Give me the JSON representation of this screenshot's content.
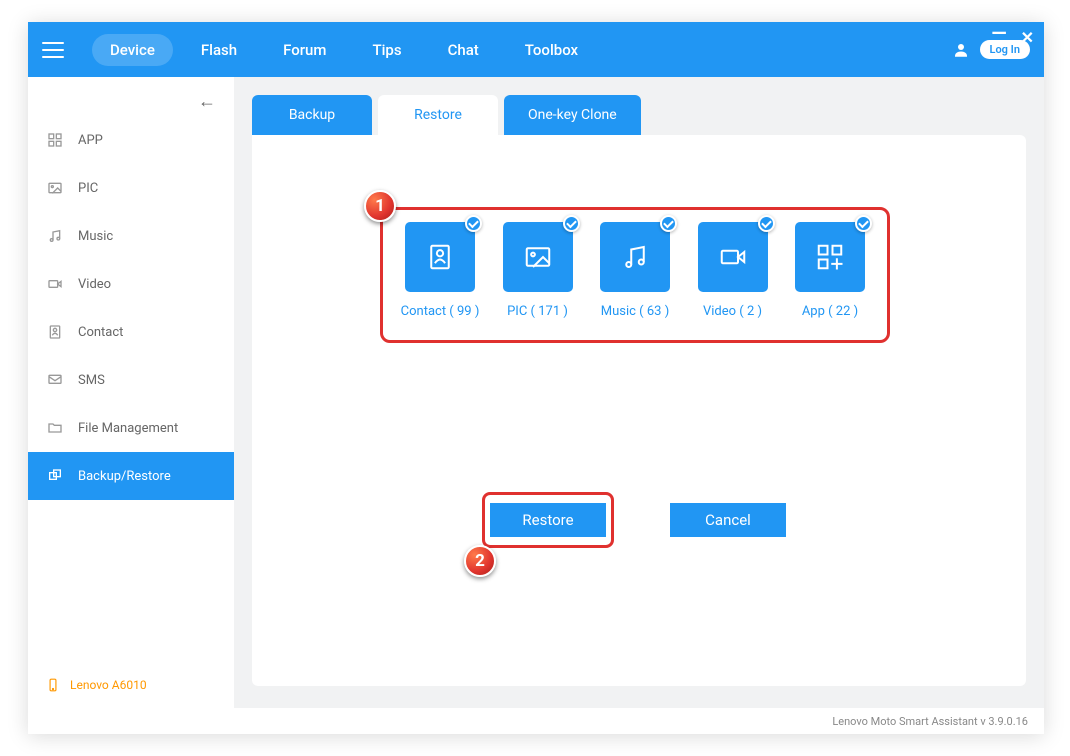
{
  "nav": {
    "items": [
      "Device",
      "Flash",
      "Forum",
      "Tips",
      "Chat",
      "Toolbox"
    ],
    "login": "Log In"
  },
  "sidebar": {
    "items": [
      {
        "label": "APP"
      },
      {
        "label": "PIC"
      },
      {
        "label": "Music"
      },
      {
        "label": "Video"
      },
      {
        "label": "Contact"
      },
      {
        "label": "SMS"
      },
      {
        "label": "File Management"
      },
      {
        "label": "Backup/Restore"
      }
    ],
    "device": "Lenovo A6010"
  },
  "tabs": {
    "backup": "Backup",
    "restore": "Restore",
    "clone": "One-key Clone"
  },
  "restore_items": [
    {
      "name": "Contact",
      "count": 99
    },
    {
      "name": "PIC",
      "count": 171
    },
    {
      "name": "Music",
      "count": 63
    },
    {
      "name": "Video",
      "count": 2
    },
    {
      "name": "App",
      "count": 22
    }
  ],
  "restore_labels": {
    "contact": "Contact ( 99 )",
    "pic": "PIC ( 171 )",
    "music": "Music ( 63 )",
    "video": "Video ( 2 )",
    "app": "App ( 22 )"
  },
  "buttons": {
    "restore": "Restore",
    "cancel": "Cancel"
  },
  "annotations": {
    "one": "1",
    "two": "2"
  },
  "footer": "Lenovo Moto Smart Assistant v 3.9.0.16"
}
